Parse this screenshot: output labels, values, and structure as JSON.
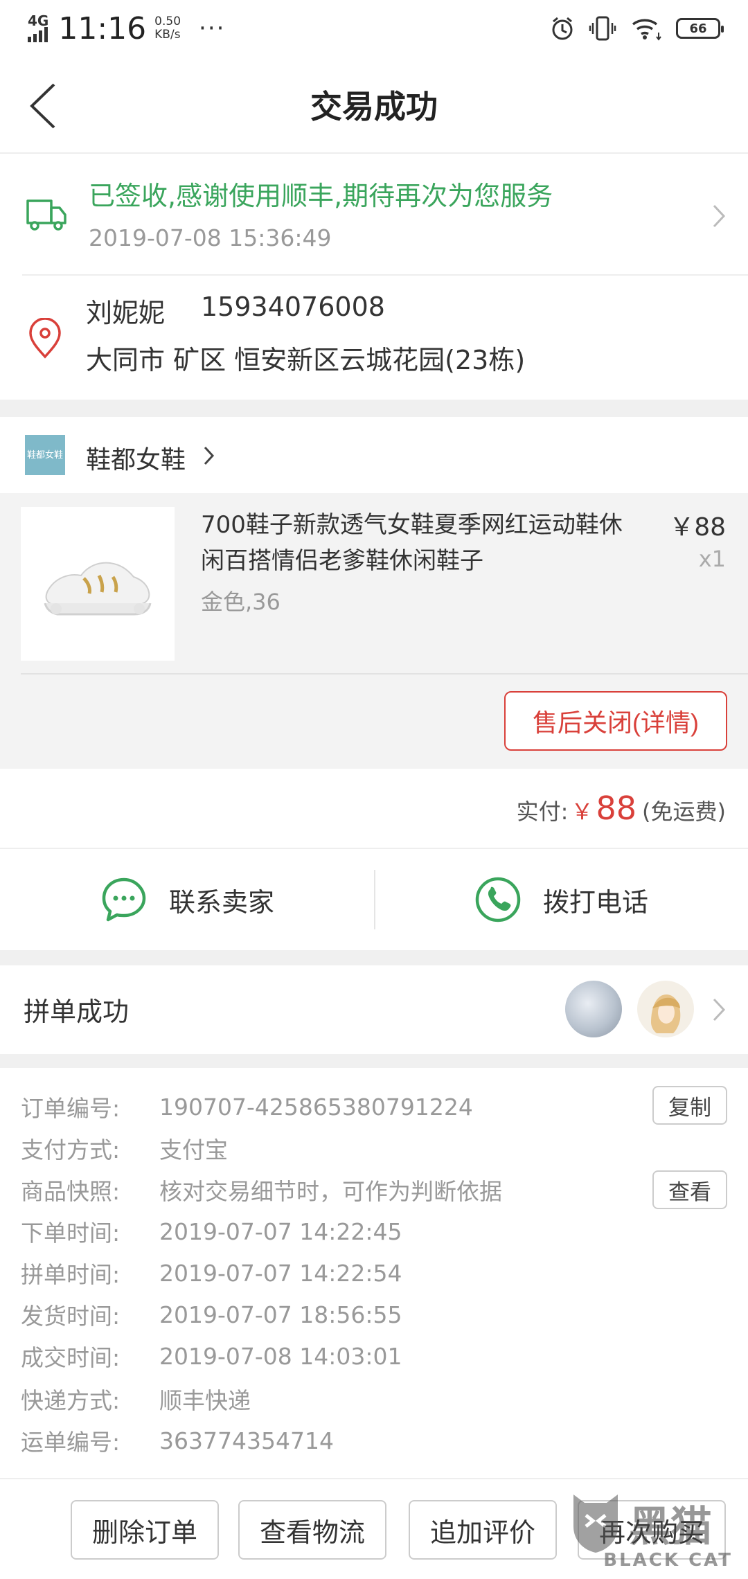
{
  "status_bar": {
    "network": "4G",
    "time": "11:16",
    "speed_value": "0.50",
    "speed_unit": "KB/s",
    "more": "···",
    "battery": "66"
  },
  "header": {
    "title": "交易成功"
  },
  "logistics": {
    "status": "已签收,感谢使用顺丰,期待再次为您服务",
    "time": "2019-07-08 15:36:49",
    "accent_color": "#3aa55c"
  },
  "address": {
    "name": "刘妮妮",
    "phone": "15934076008",
    "line": "大同市 矿区 恒安新区云城花园(23栋)"
  },
  "shop": {
    "logo_text": "鞋都女鞋",
    "name": "鞋都女鞋"
  },
  "product": {
    "title": "700鞋子新款透气女鞋夏季网红运动鞋休闲百搭情侣老爹鞋休闲鞋子",
    "price": "￥88",
    "qty": "x1",
    "spec": "金色,36",
    "after_sale_button": "售后关闭(详情)"
  },
  "payment": {
    "label": "实付:",
    "currency": "￥",
    "amount": "88",
    "shipping": "(免运费)",
    "price_color": "#d9403a"
  },
  "contact": {
    "chat_label": "联系卖家",
    "call_label": "拨打电话"
  },
  "group": {
    "label": "拼单成功"
  },
  "order_details": {
    "rows": [
      {
        "key": "订单编号:",
        "value": "190707-425865380791224"
      },
      {
        "key": "支付方式:",
        "value": "支付宝"
      },
      {
        "key": "商品快照:",
        "value": "核对交易细节时，可作为判断依据"
      },
      {
        "key": "下单时间:",
        "value": "2019-07-07 14:22:45"
      },
      {
        "key": "拼单时间:",
        "value": "2019-07-07 14:22:54"
      },
      {
        "key": "发货时间:",
        "value": "2019-07-07 18:56:55"
      },
      {
        "key": "成交时间:",
        "value": "2019-07-08 14:03:01"
      },
      {
        "key": "快递方式:",
        "value": "顺丰快递"
      },
      {
        "key": "运单编号:",
        "value": "363774354714"
      }
    ],
    "copy_button": "复制",
    "view_button": "查看"
  },
  "actions": {
    "delete": "删除订单",
    "logistics": "查看物流",
    "review": "追加评价",
    "rebuy": "再次购买"
  },
  "watermark": {
    "text": "BLACK CAT",
    "logo_text": "黑猫"
  }
}
